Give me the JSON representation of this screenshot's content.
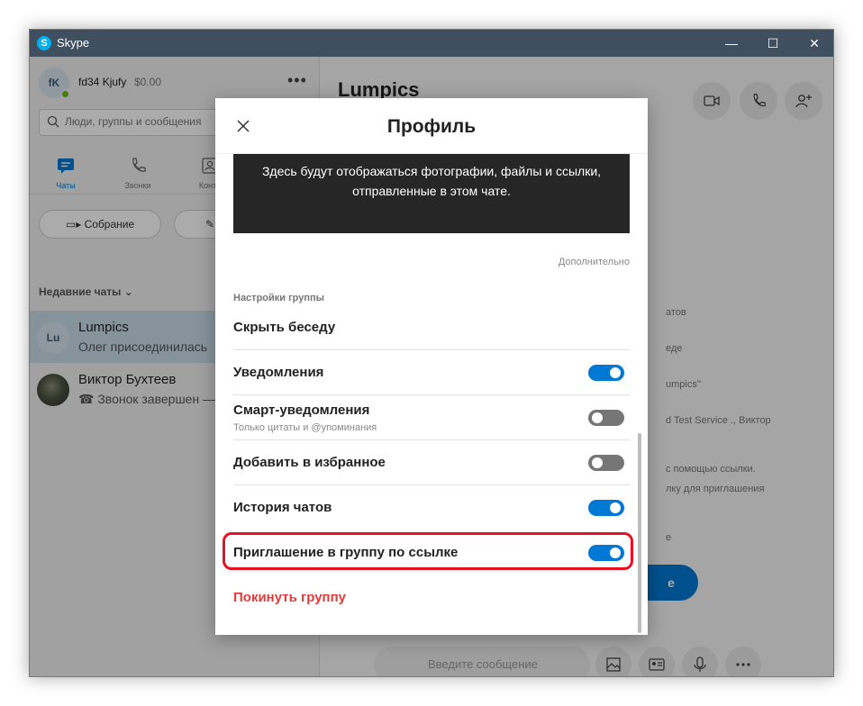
{
  "window": {
    "app_name": "Skype",
    "logo_letter": "S",
    "minimize": "—",
    "maximize": "☐",
    "close": "✕"
  },
  "profile": {
    "initials": "fK",
    "name": "fd34 Kjufy",
    "balance": "$0.00"
  },
  "search": {
    "placeholder": "Люди, группы и сообщения"
  },
  "nav": {
    "chats": "Чаты",
    "calls": "Звонки",
    "contacts": "Конта"
  },
  "actions": {
    "meeting": "Собрание"
  },
  "recent_label": "Недавние чаты",
  "chats": [
    {
      "initials": "Lu",
      "name": "Lumpics",
      "last_message": "Олег присоединилась"
    },
    {
      "initials": "",
      "name": "Виктор Бухтеев",
      "last_message": "Звонок завершен —"
    }
  ],
  "main": {
    "title": "Lumpics",
    "side_texts": [
      "атов",
      "еде",
      "umpics\"",
      "d Test Service ., Виктор",
      "с помощью ссылки.",
      "лку для приглашения",
      "е"
    ],
    "join_label": "е",
    "compose_placeholder": "Введите сообщение"
  },
  "modal": {
    "title": "Профиль",
    "media_text": "Здесь будут отображаться фотографии, файлы и ссылки, отправленные в этом чате.",
    "more_link": "Дополнительно",
    "section_label": "Настройки группы",
    "rows": [
      {
        "label": "Скрыть беседу"
      },
      {
        "label": "Уведомления",
        "enabled": true
      },
      {
        "label": "Смарт-уведомления",
        "sub": "Только цитаты и @упоминания",
        "enabled": false
      },
      {
        "label": "Добавить в избранное",
        "enabled": false
      },
      {
        "label": "История чатов",
        "enabled": true
      },
      {
        "label": "Приглашение в группу по ссылке",
        "enabled": true
      }
    ],
    "leave_label": "Покинуть группу"
  },
  "colors": {
    "accent": "#0078d4",
    "danger": "#e13c3c",
    "highlight": "#e81123",
    "titlebar": "#3f4f5f"
  }
}
